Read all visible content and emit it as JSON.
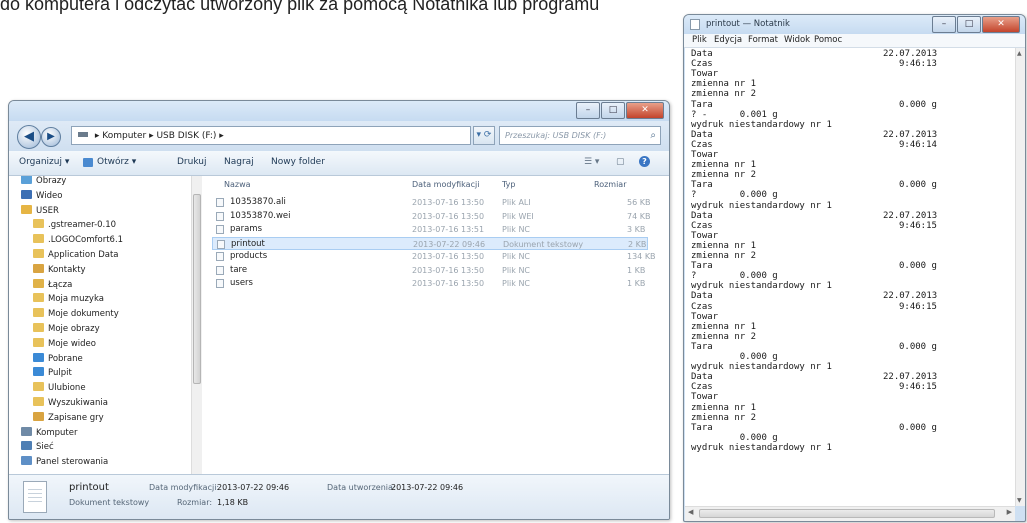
{
  "page_caption": "do komputera i odczytać utworzony plik za pomocą Notatnika lub programu",
  "explorer": {
    "address": [
      "Komputer",
      "USB DISK (F:)"
    ],
    "search_placeholder": "Przeszukaj: USB DISK (F:)",
    "toolbar": [
      "Organizuj ▾",
      "Otwórz ▾",
      "Drukuj",
      "Nagraj",
      "Nowy folder"
    ],
    "columns": [
      "Nazwa",
      "Data modyfikacji",
      "Typ",
      "Rozmiar"
    ],
    "nav_items": [
      {
        "label": "Obrazy",
        "icon": "pictures-folder-icon",
        "color": "#5aa0d8"
      },
      {
        "label": "Wideo",
        "icon": "videos-folder-icon",
        "color": "#3c6fb4"
      },
      {
        "label": "USER",
        "icon": "user-folder-icon",
        "color": "#e6b544"
      },
      {
        "label": ".gstreamer-0.10",
        "icon": "folder-icon",
        "color": "#e8c25a"
      },
      {
        "label": ".LOGOComfort6.1",
        "icon": "folder-icon",
        "color": "#e8c25a"
      },
      {
        "label": "Application Data",
        "icon": "folder-shortcut-icon",
        "color": "#e8c25a"
      },
      {
        "label": "Kontakty",
        "icon": "contacts-folder-icon",
        "color": "#d9a441"
      },
      {
        "label": "Łącza",
        "icon": "links-folder-icon",
        "color": "#e0b248"
      },
      {
        "label": "Moja muzyka",
        "icon": "music-folder-icon",
        "color": "#e8c25a"
      },
      {
        "label": "Moje dokumenty",
        "icon": "documents-folder-icon",
        "color": "#e8c25a"
      },
      {
        "label": "Moje obrazy",
        "icon": "pictures-folder-icon",
        "color": "#e8c25a"
      },
      {
        "label": "Moje wideo",
        "icon": "videos-folder-icon",
        "color": "#e8c25a"
      },
      {
        "label": "Pobrane",
        "icon": "downloads-folder-icon",
        "color": "#3b8ad6"
      },
      {
        "label": "Pulpit",
        "icon": "desktop-folder-icon",
        "color": "#3b8ad6"
      },
      {
        "label": "Ulubione",
        "icon": "favorites-folder-icon",
        "color": "#e8c25a"
      },
      {
        "label": "Wyszukiwania",
        "icon": "searches-folder-icon",
        "color": "#e8c25a"
      },
      {
        "label": "Zapisane gry",
        "icon": "saved-games-folder-icon",
        "color": "#d9a441"
      },
      {
        "label": "Komputer",
        "icon": "computer-icon",
        "color": "#6f8aa6"
      },
      {
        "label": "Sieć",
        "icon": "network-icon",
        "color": "#4f7fb4"
      },
      {
        "label": "Panel sterowania",
        "icon": "control-panel-icon",
        "color": "#5e8fc6"
      }
    ],
    "files": [
      {
        "name": "10353870.ali",
        "date": "2013-07-16 13:50",
        "type": "Plik ALI",
        "size": "56 KB"
      },
      {
        "name": "10353870.wei",
        "date": "2013-07-16 13:50",
        "type": "Plik WEI",
        "size": "74 KB"
      },
      {
        "name": "params",
        "date": "2013-07-16 13:51",
        "type": "Plik NC",
        "size": "3 KB"
      },
      {
        "name": "printout",
        "date": "2013-07-22 09:46",
        "type": "Dokument tekstowy",
        "size": "2 KB",
        "selected": true
      },
      {
        "name": "products",
        "date": "2013-07-16 13:50",
        "type": "Plik NC",
        "size": "134 KB"
      },
      {
        "name": "tare",
        "date": "2013-07-16 13:50",
        "type": "Plik NC",
        "size": "1 KB"
      },
      {
        "name": "users",
        "date": "2013-07-16 13:50",
        "type": "Plik NC",
        "size": "1 KB"
      }
    ],
    "details": {
      "name": "printout",
      "type": "Dokument tekstowy",
      "modified_label": "Data modyfikacji:",
      "modified_value": "2013-07-22 09:46",
      "created_label": "Data utworzenia:",
      "created_value": "2013-07-22 09:46",
      "size_label": "Rozmiar:",
      "size_value": "1,18 KB"
    }
  },
  "notepad": {
    "title": "printout — Notatnik",
    "menu": [
      "Plik",
      "Edycja",
      "Format",
      "Widok",
      "Pomoc"
    ],
    "lines": [
      [
        "Data",
        "22.07.2013"
      ],
      [
        "Czas",
        "9:46:13"
      ],
      [
        "Towar",
        ""
      ],
      [
        "zmienna nr 1",
        ""
      ],
      [
        "zmienna nr 2",
        ""
      ],
      [
        "Tara",
        "0.000 g"
      ],
      [
        "? -      0.001 g",
        ""
      ],
      [
        "wydruk niestandardowy nr 1",
        ""
      ],
      [
        "Data",
        "22.07.2013"
      ],
      [
        "Czas",
        "9:46:14"
      ],
      [
        "Towar",
        ""
      ],
      [
        "zmienna nr 1",
        ""
      ],
      [
        "zmienna nr 2",
        ""
      ],
      [
        "Tara",
        "0.000 g"
      ],
      [
        "?        0.000 g",
        ""
      ],
      [
        "wydruk niestandardowy nr 1",
        ""
      ],
      [
        "Data",
        "22.07.2013"
      ],
      [
        "Czas",
        "9:46:15"
      ],
      [
        "Towar",
        ""
      ],
      [
        "zmienna nr 1",
        ""
      ],
      [
        "zmienna nr 2",
        ""
      ],
      [
        "Tara",
        "0.000 g"
      ],
      [
        "?        0.000 g",
        ""
      ],
      [
        "wydruk niestandardowy nr 1",
        ""
      ],
      [
        "Data",
        "22.07.2013"
      ],
      [
        "Czas",
        "9:46:15"
      ],
      [
        "Towar",
        ""
      ],
      [
        "zmienna nr 1",
        ""
      ],
      [
        "zmienna nr 2",
        ""
      ],
      [
        "Tara",
        "0.000 g"
      ],
      [
        "         0.000 g",
        ""
      ],
      [
        "wydruk niestandardowy nr 1",
        ""
      ],
      [
        "Data",
        "22.07.2013"
      ],
      [
        "Czas",
        "9:46:15"
      ],
      [
        "Towar",
        ""
      ],
      [
        "zmienna nr 1",
        ""
      ],
      [
        "zmienna nr 2",
        ""
      ],
      [
        "Tara",
        "0.000 g"
      ],
      [
        "         0.000 g",
        ""
      ],
      [
        "wydruk niestandardowy nr 1",
        ""
      ]
    ]
  }
}
